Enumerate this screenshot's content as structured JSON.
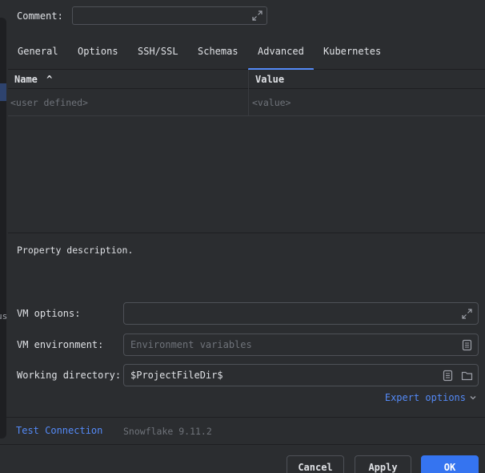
{
  "comment": {
    "label": "Comment:",
    "value": ""
  },
  "tabs": [
    {
      "label": "General"
    },
    {
      "label": "Options"
    },
    {
      "label": "SSH/SSL"
    },
    {
      "label": "Schemas"
    },
    {
      "label": "Advanced",
      "active": true
    },
    {
      "label": "Kubernetes"
    }
  ],
  "table": {
    "headers": {
      "name": "Name",
      "value": "Value"
    },
    "sort_indicator": "^",
    "rows": [
      {
        "name_placeholder": "<user defined>",
        "value_placeholder": "<value>"
      }
    ]
  },
  "description": "Property description.",
  "vm_options": {
    "label": "VM options:",
    "value": ""
  },
  "vm_environment": {
    "label": "VM environment:",
    "placeholder": "Environment variables"
  },
  "working_directory": {
    "label": "Working directory:",
    "value": "$ProjectFileDir$"
  },
  "expert_options": "Expert options",
  "left_fragment": "us",
  "test_connection": "Test Connection",
  "driver_info": "Snowflake 9.11.2",
  "buttons": {
    "cancel": "Cancel",
    "apply": "Apply",
    "ok": "OK"
  },
  "colors": {
    "accent": "#548af7",
    "primary_button": "#3574f0",
    "background": "#2b2d30"
  }
}
